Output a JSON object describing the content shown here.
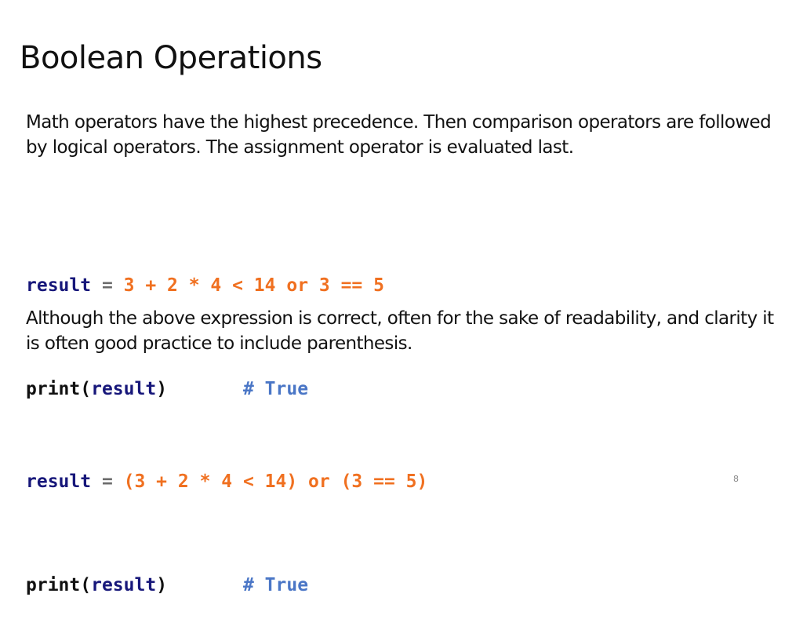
{
  "slide": {
    "title": "Boolean Operations",
    "page_number": "8"
  },
  "paragraphs": [
    "Math operators have the highest precedence. Then comparison operators are followed by logical operators. The assignment operator is evaluated last.",
    "Although the above expression is correct, often for the sake of readability, and clarity it is often good practice to include parenthesis."
  ],
  "code_blocks": [
    {
      "assign_var": "result",
      "assign_op": " = ",
      "expression": "3 + 2 * 4 < 14 or 3 == 5",
      "print_fn": "print(",
      "print_arg": "result",
      "print_close": ")",
      "spacer": "       ",
      "comment": "# True"
    },
    {
      "assign_var": "result",
      "assign_op": " = ",
      "expression": "(3 + 2 * 4 < 14) or (3 == 5)",
      "print_fn": "print(",
      "print_arg": "result",
      "print_close": ")",
      "spacer": "       ",
      "comment": "# True"
    }
  ],
  "colors": {
    "variable": "#17177a",
    "operator": "#6b6b6b",
    "expression": "#f07020",
    "comment": "#4a76c6"
  }
}
